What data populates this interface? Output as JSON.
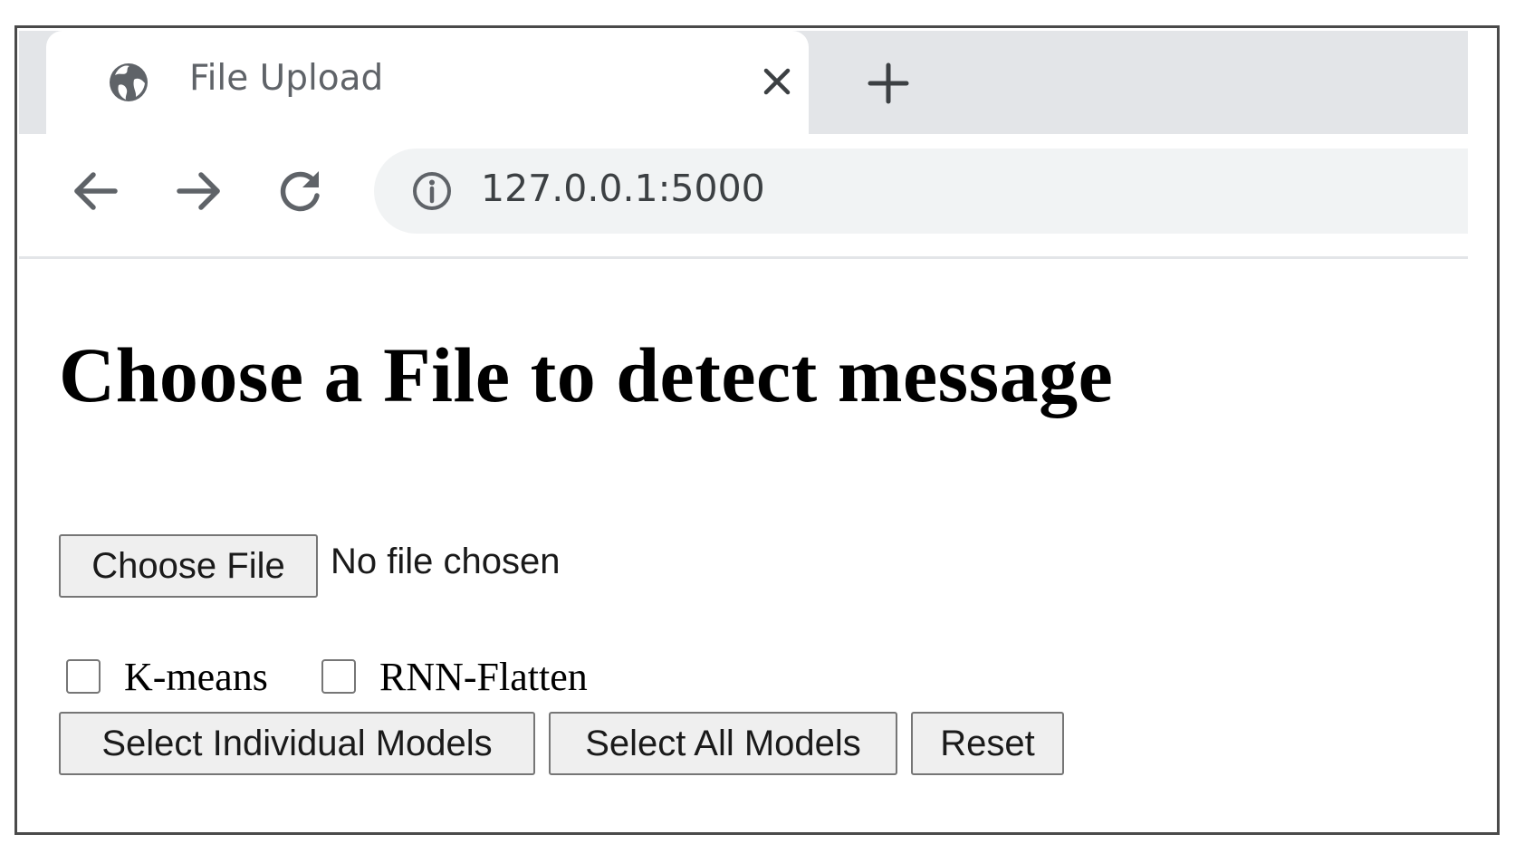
{
  "browser": {
    "tab": {
      "title": "File Upload",
      "icon": "globe-icon",
      "close_icon": "close-icon"
    },
    "new_tab_icon": "plus-icon",
    "nav": {
      "back_icon": "back-arrow-icon",
      "forward_icon": "forward-arrow-icon",
      "reload_icon": "reload-icon"
    },
    "address_bar": {
      "info_icon": "info-icon",
      "url": "127.0.0.1:5000"
    }
  },
  "page": {
    "heading": "Choose a File to detect message",
    "file_input": {
      "button_label": "Choose File",
      "status": "No file chosen"
    },
    "models": [
      {
        "label": "K-means",
        "checked": false
      },
      {
        "label": "RNN-Flatten",
        "checked": false
      }
    ],
    "buttons": {
      "individual": "Select Individual Models",
      "all": "Select All Models",
      "reset": "Reset"
    }
  },
  "colors": {
    "tabstrip": "#e3e5e8",
    "omnibox": "#f1f3f4",
    "button_bg": "#efefef",
    "button_border": "#767676",
    "frame_border": "#4a4a4a"
  }
}
